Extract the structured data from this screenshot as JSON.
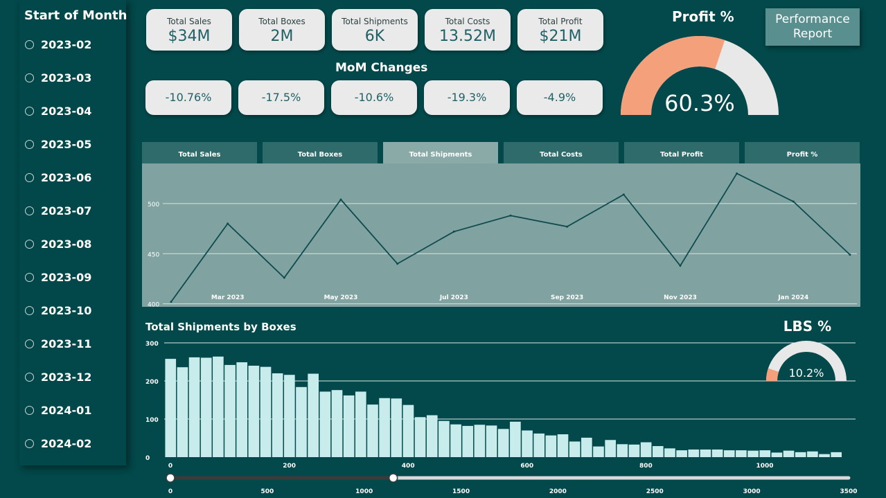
{
  "sidebar": {
    "title": "Start of Month",
    "months": [
      "2023-02",
      "2023-03",
      "2023-04",
      "2023-05",
      "2023-06",
      "2023-07",
      "2023-08",
      "2023-09",
      "2023-10",
      "2023-11",
      "2023-12",
      "2024-01",
      "2024-02"
    ]
  },
  "kpis": [
    {
      "label": "Total Sales",
      "value": "$34M"
    },
    {
      "label": "Total Boxes",
      "value": "2M"
    },
    {
      "label": "Total Shipments",
      "value": "6K"
    },
    {
      "label": "Total Costs",
      "value": "13.52M"
    },
    {
      "label": "Total Profit",
      "value": "$21M"
    }
  ],
  "mom": {
    "title": "MoM Changes",
    "values": [
      "-10.76%",
      "-17.5%",
      "-10.6%",
      "-19.3%",
      "-4.9%"
    ]
  },
  "profit_gauge": {
    "title": "Profit %",
    "value_text": "60.3%",
    "fraction": 0.603,
    "fill_color": "#f4a07a",
    "track_color": "#e8e8e8"
  },
  "lbs_gauge": {
    "title": "LBS %",
    "value_text": "10.2%",
    "fraction": 0.102,
    "fill_color": "#f4a07a",
    "track_color": "#e8e8e8"
  },
  "performance_button": {
    "line1": "Performance",
    "line2": "Report"
  },
  "tabs": [
    {
      "label": "Total Sales",
      "active": false
    },
    {
      "label": "Total Boxes",
      "active": false
    },
    {
      "label": "Total Shipments",
      "active": true
    },
    {
      "label": "Total Costs",
      "active": false
    },
    {
      "label": "Total Profit",
      "active": false
    },
    {
      "label": "Profit %",
      "active": false
    }
  ],
  "bar_section": {
    "title": "Total Shipments by Boxes"
  },
  "colors": {
    "background": "#03484a",
    "accent": "#f4a07a",
    "line": "#0e4a4e",
    "bars": "#c8ecec"
  },
  "chart_data": [
    {
      "type": "line",
      "title": "",
      "x": [
        "2023-02",
        "2023-03",
        "2023-04",
        "2023-05",
        "2023-06",
        "2023-07",
        "2023-08",
        "2023-09",
        "2023-10",
        "2023-11",
        "2023-12",
        "2024-01",
        "2024-02"
      ],
      "x_tick_labels": [
        "Mar 2023",
        "May 2023",
        "Jul 2023",
        "Sep 2023",
        "Nov 2023",
        "Jan 2024"
      ],
      "x_tick_positions": [
        "2023-03",
        "2023-05",
        "2023-07",
        "2023-09",
        "2023-11",
        "2024-01"
      ],
      "series": [
        {
          "values": [
            402,
            480,
            426,
            504,
            440,
            472,
            488,
            477,
            509,
            438,
            530,
            502,
            449
          ]
        }
      ],
      "yticks": [
        400,
        450,
        500
      ],
      "ylim": [
        397,
        540
      ],
      "grid": true
    },
    {
      "type": "bar",
      "title": "Total Shipments by Boxes",
      "xticks": [
        0,
        200,
        400,
        600,
        800,
        1000
      ],
      "yticks": [
        0,
        100,
        200,
        300
      ],
      "ylim": [
        0,
        300
      ],
      "bin_width": 20,
      "values": [
        258,
        236,
        262,
        261,
        264,
        242,
        249,
        240,
        237,
        220,
        216,
        184,
        219,
        172,
        176,
        162,
        172,
        138,
        155,
        154,
        137,
        105,
        110,
        95,
        86,
        82,
        85,
        83,
        74,
        93,
        70,
        62,
        57,
        60,
        41,
        51,
        28,
        45,
        34,
        33,
        39,
        29,
        23,
        18,
        20,
        20,
        20,
        18,
        18,
        17,
        18,
        12,
        17,
        13,
        15,
        8,
        13
      ]
    }
  ],
  "range_slider": {
    "ticks": [
      "0",
      "500",
      "1000",
      "1500",
      "2000",
      "2500",
      "3000",
      "3500"
    ],
    "min_value": 0,
    "max_value": 1150,
    "domain": [
      0,
      3500
    ]
  }
}
